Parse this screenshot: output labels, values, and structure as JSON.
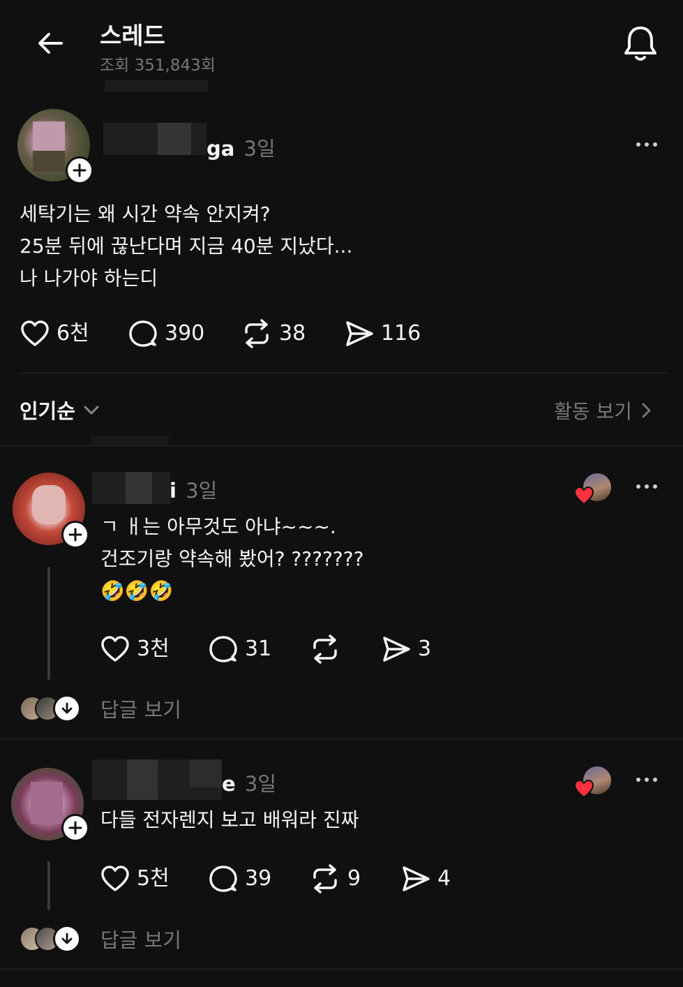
{
  "header": {
    "title": "스레드",
    "views": "조회 351,843회"
  },
  "post": {
    "username_visible": "ga",
    "time": "3일",
    "lines": [
      "세탁기는 왜 시간 약속 안지켜?",
      "25분 뒤에 끊난다며 지금 40분 지났다...",
      "나 나가야 하는디"
    ],
    "likes": "6천",
    "comments": "390",
    "reposts": "38",
    "shares": "116"
  },
  "sort": {
    "label": "인기순",
    "activity": "활동 보기"
  },
  "replies": [
    {
      "username_visible": "i",
      "time": "3일",
      "lines": [
        "ㄱ ㅐ는 아무것도 아냐~~~.",
        "건조기랑 약속해 봤어? ???????",
        "🤣🤣🤣"
      ],
      "likes": "3천",
      "comments": "31",
      "reposts": "",
      "shares": "3",
      "view_replies": "답글 보기"
    },
    {
      "username_visible": "e",
      "time": "3일",
      "lines": [
        "다들 전자렌지 보고 배워라 진짜"
      ],
      "likes": "5천",
      "comments": "39",
      "reposts": "9",
      "shares": "4",
      "view_replies": "답글 보기"
    }
  ],
  "colors": {
    "background": "#101010",
    "text": "#f3f5f7",
    "secondary": "#777777",
    "like_heart": "#ff3040"
  }
}
